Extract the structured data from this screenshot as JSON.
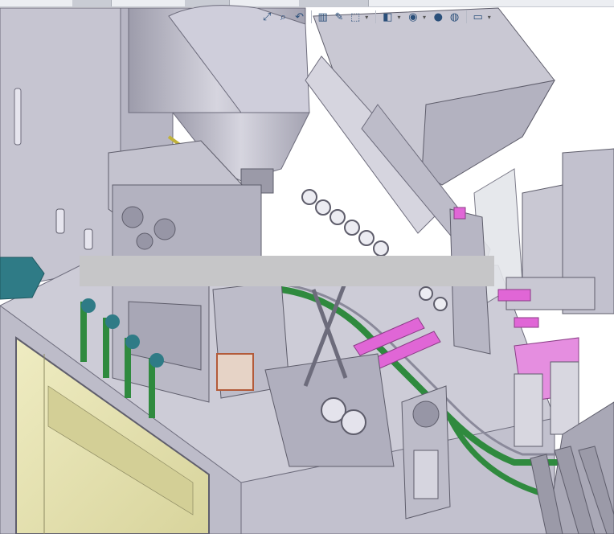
{
  "window": {
    "kind": "3D CAD assembly viewport"
  },
  "toolbar": {
    "items": [
      {
        "icon": "zoom-to-fit-icon",
        "glyph": "⤢"
      },
      {
        "icon": "zoom-area-icon",
        "glyph": "⌕"
      },
      {
        "icon": "previous-view-icon",
        "glyph": "↶"
      },
      {
        "icon": "section-view-icon",
        "glyph": "▥"
      },
      {
        "icon": "dynamic-annotation-icon",
        "glyph": "✎"
      },
      {
        "icon": "view-orientation-icon",
        "glyph": "⬚"
      },
      {
        "icon": "display-style-icon",
        "glyph": "◧"
      },
      {
        "icon": "hide-show-items-icon",
        "glyph": "◉"
      },
      {
        "icon": "edit-appearance-icon",
        "glyph": "●"
      },
      {
        "icon": "apply-scene-icon",
        "glyph": "◍"
      },
      {
        "icon": "view-settings-icon",
        "glyph": "▭"
      }
    ]
  },
  "colors": {
    "background": "#ffffff",
    "machine_body": "#c9c8d3",
    "machine_shadow": "#a9a8b6",
    "frame_dark": "#8a899a",
    "window_glass": "#e9e6b4",
    "conveyor_belt": "#2f8a3e",
    "pneumatic_cylinder": "#e066d6",
    "pink_block": "#e58ee0",
    "teal_part": "#2f7b86",
    "hopper": "#b9b8c4",
    "redaction": "#c6c6c8"
  }
}
